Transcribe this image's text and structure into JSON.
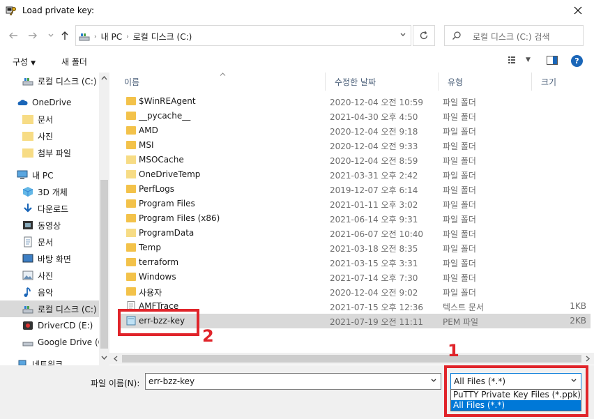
{
  "window": {
    "title": "Load private key:"
  },
  "address": {
    "crumbs": [
      "내 PC",
      "로컬 디스크 (C:)"
    ],
    "search_placeholder": "로컬 디스크 (C:) 검색"
  },
  "toolbar": {
    "organize": "구성",
    "new_folder": "새 폴더"
  },
  "sidebar": {
    "items": [
      {
        "label": "로컬 디스크 (C:)",
        "icon": "drive-icon"
      },
      {
        "label": "OneDrive",
        "icon": "cloud-icon"
      },
      {
        "label": "문서",
        "icon": "folder-icon"
      },
      {
        "label": "사진",
        "icon": "folder-icon"
      },
      {
        "label": "첨부 파일",
        "icon": "folder-icon"
      },
      {
        "label": "내 PC",
        "icon": "pc-icon"
      },
      {
        "label": "3D 개체",
        "icon": "cube-icon"
      },
      {
        "label": "다운로드",
        "icon": "download-icon"
      },
      {
        "label": "동영상",
        "icon": "video-icon"
      },
      {
        "label": "문서",
        "icon": "document-icon"
      },
      {
        "label": "바탕 화면",
        "icon": "desktop-icon"
      },
      {
        "label": "사진",
        "icon": "picture-icon"
      },
      {
        "label": "음악",
        "icon": "music-icon"
      },
      {
        "label": "로컬 디스크 (C:)",
        "icon": "drive-icon"
      },
      {
        "label": "DriverCD (E:)",
        "icon": "cd-icon"
      },
      {
        "label": "Google Drive (G",
        "icon": "drive-icon"
      },
      {
        "label": "네트워크",
        "icon": "network-icon"
      }
    ]
  },
  "columns": {
    "name": "이름",
    "date": "수정한 날짜",
    "type": "유형",
    "size": "크기"
  },
  "files": [
    {
      "name": "$WinREAgent",
      "date": "2020-12-04 오전 10:59",
      "type": "파일 폴더",
      "size": "",
      "kind": "folder"
    },
    {
      "name": "__pycache__",
      "date": "2021-04-30 오후 4:50",
      "type": "파일 폴더",
      "size": "",
      "kind": "folder"
    },
    {
      "name": "AMD",
      "date": "2020-12-04 오전 9:18",
      "type": "파일 폴더",
      "size": "",
      "kind": "folder"
    },
    {
      "name": "MSI",
      "date": "2020-12-04 오전 9:33",
      "type": "파일 폴더",
      "size": "",
      "kind": "folder"
    },
    {
      "name": "MSOCache",
      "date": "2020-12-04 오전 8:59",
      "type": "파일 폴더",
      "size": "",
      "kind": "folder-light"
    },
    {
      "name": "OneDriveTemp",
      "date": "2021-03-31 오후 2:42",
      "type": "파일 폴더",
      "size": "",
      "kind": "folder-light"
    },
    {
      "name": "PerfLogs",
      "date": "2019-12-07 오후 6:14",
      "type": "파일 폴더",
      "size": "",
      "kind": "folder"
    },
    {
      "name": "Program Files",
      "date": "2021-01-11 오후 3:02",
      "type": "파일 폴더",
      "size": "",
      "kind": "folder"
    },
    {
      "name": "Program Files (x86)",
      "date": "2021-06-14 오후 9:31",
      "type": "파일 폴더",
      "size": "",
      "kind": "folder"
    },
    {
      "name": "ProgramData",
      "date": "2021-06-07 오전 10:40",
      "type": "파일 폴더",
      "size": "",
      "kind": "folder-light"
    },
    {
      "name": "Temp",
      "date": "2021-03-18 오전 8:35",
      "type": "파일 폴더",
      "size": "",
      "kind": "folder"
    },
    {
      "name": "terraform",
      "date": "2021-03-15 오후 3:31",
      "type": "파일 폴더",
      "size": "",
      "kind": "folder"
    },
    {
      "name": "Windows",
      "date": "2021-07-14 오후 7:30",
      "type": "파일 폴더",
      "size": "",
      "kind": "folder"
    },
    {
      "name": "사용자",
      "date": "2020-12-04 오전 9:02",
      "type": "파일 폴더",
      "size": "",
      "kind": "folder"
    },
    {
      "name": "AMFTrace",
      "date": "2021-07-15 오후 12:36",
      "type": "텍스트 문서",
      "size": "1KB",
      "kind": "text"
    },
    {
      "name": "err-bzz-key",
      "date": "2021-07-19 오전 11:11",
      "type": "PEM 파일",
      "size": "2KB",
      "kind": "pem"
    }
  ],
  "bottom": {
    "filename_label": "파일 이름(N):",
    "filename_value": "err-bzz-key",
    "filetype_value": "All Files (*.*)",
    "filetype_options": [
      "PuTTY Private Key Files (*.ppk)",
      "All Files (*.*)"
    ]
  },
  "annotations": {
    "one": "1",
    "two": "2"
  },
  "colors": {
    "accent": "#0078d7",
    "highlight": "#e0242a",
    "folder": "#f3c24a"
  }
}
